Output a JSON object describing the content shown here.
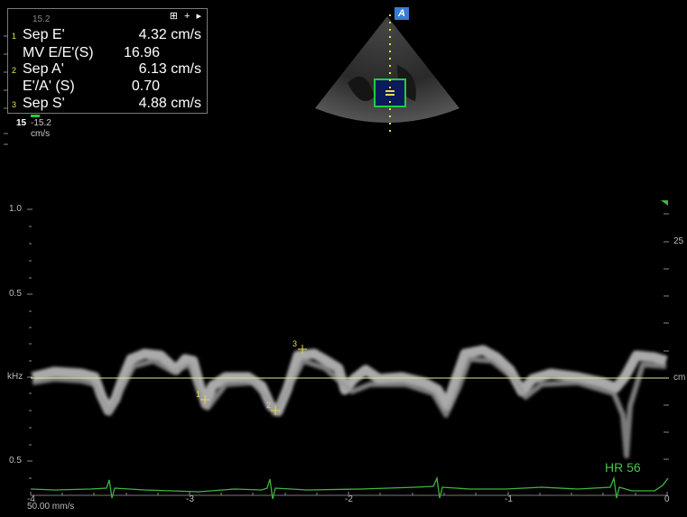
{
  "panel": {
    "tools": "⊞ + ▸",
    "rows": [
      {
        "index": "1",
        "label": "Sep E'",
        "value": "4.32 cm/s"
      },
      {
        "index": "",
        "label": "MV E/E'(S)",
        "value": "16.96"
      },
      {
        "index": "2",
        "label": "Sep A'",
        "value": "6.13 cm/s"
      },
      {
        "index": "",
        "label": "E'/A' (S)",
        "value": "0.70"
      },
      {
        "index": "3",
        "label": "Sep S'",
        "value": "4.88 cm/s"
      }
    ]
  },
  "top_scale": {
    "top_value": "15.2",
    "bottom_label": "15",
    "bottom_value": "-15.2",
    "unit": "cm/s"
  },
  "left_axis": {
    "labels": [
      "1.0",
      "0.5",
      "kHz",
      "0.5"
    ]
  },
  "right_axis": {
    "labels": [
      "25",
      "cm"
    ]
  },
  "time_axis": {
    "labels": [
      "-4",
      "-3",
      "-2",
      "-1",
      "0"
    ]
  },
  "sweep_speed": "50.00 mm/s",
  "heart_rate": "HR 56",
  "markers": [
    "1",
    "2",
    "3"
  ],
  "thumbnail_badge": "A",
  "colors": {
    "ecg": "#3fb53f",
    "baseline": "#e8e08a",
    "marker": "#e8d84a",
    "roi": "#22cc44"
  }
}
